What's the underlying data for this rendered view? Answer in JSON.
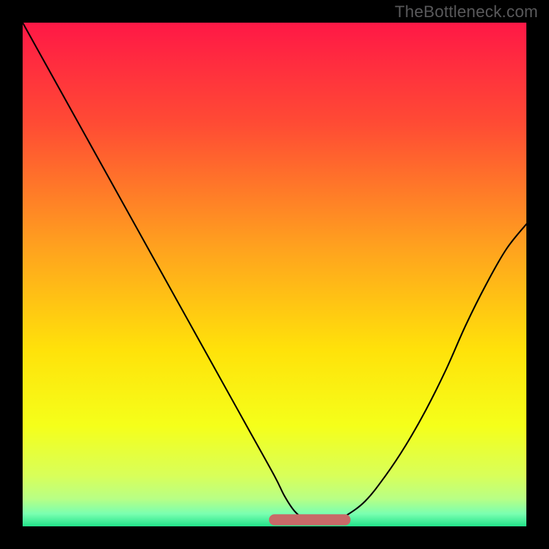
{
  "watermark": "TheBottleneck.com",
  "colors": {
    "frame": "#000000",
    "gradient_stops": [
      {
        "offset": 0.0,
        "color": "#ff1846"
      },
      {
        "offset": 0.2,
        "color": "#ff4b34"
      },
      {
        "offset": 0.45,
        "color": "#ffa31e"
      },
      {
        "offset": 0.65,
        "color": "#ffe20a"
      },
      {
        "offset": 0.8,
        "color": "#f5ff1a"
      },
      {
        "offset": 0.9,
        "color": "#d8ff5a"
      },
      {
        "offset": 0.945,
        "color": "#b8ff85"
      },
      {
        "offset": 0.975,
        "color": "#7affb0"
      },
      {
        "offset": 1.0,
        "color": "#22e38a"
      }
    ],
    "curve": "#000000",
    "band": "#c86a68"
  },
  "chart_data": {
    "type": "line",
    "title": "",
    "xlabel": "",
    "ylabel": "",
    "xlim": [
      0,
      100
    ],
    "ylim": [
      0,
      100
    ],
    "series": [
      {
        "name": "bottleneck_curve",
        "x": [
          0,
          5,
          10,
          15,
          20,
          25,
          30,
          35,
          40,
          45,
          50,
          52,
          54,
          56,
          58,
          60,
          62,
          64,
          68,
          72,
          76,
          80,
          84,
          88,
          92,
          96,
          100
        ],
        "y": [
          100,
          91,
          82,
          73,
          64,
          55,
          46,
          37,
          28,
          19,
          10,
          6,
          3,
          1.5,
          1,
          1,
          1.2,
          2,
          5,
          10,
          16,
          23,
          31,
          40,
          48,
          55,
          60
        ]
      }
    ],
    "annotations": [
      {
        "name": "optimal_band",
        "x_range": [
          50,
          64
        ],
        "y": 1.3,
        "thickness": 2.2
      }
    ]
  }
}
